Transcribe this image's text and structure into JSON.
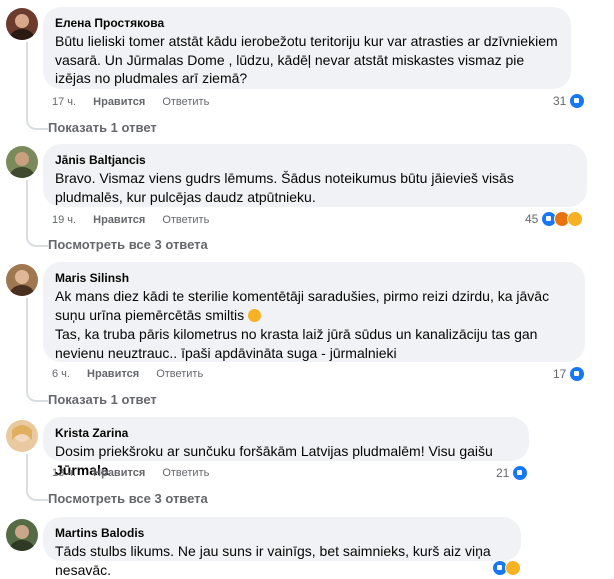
{
  "comments": [
    {
      "author": "Елена Простякова",
      "text": "Būtu lieliski tomer atstāt kādu ierobežotu teritoriju kur var atrasties ar dzīvniekiem vasarā. Un Jūrmalas Dome , lūdzu, kādēļ nevar atstāt miskastes vismaz pie izējas no pludmales arī ziemā?",
      "time": "17 ч.",
      "like_label": "Нравится",
      "reply_label": "Ответить",
      "reaction_count": "31",
      "replies_label": "Показать 1 ответ",
      "avatar_color": "#6b3b2e"
    },
    {
      "author": "Jānis Baltjancis",
      "text": "Bravo. Vismaz viens gudrs lēmums. Šādus noteikumus būtu jāievieš visās pludmalēs, kur pulcējas daudz atpūtnieku.",
      "time": "19 ч.",
      "like_label": "Нравится",
      "reply_label": "Ответить",
      "reaction_count": "45",
      "replies_label": "Посмотреть все 3 ответа",
      "avatar_color": "#7a8a5a"
    },
    {
      "author": "Maris Silinsh",
      "text_line1": "Ak mans diez kādi te sterilie komentētāji saradušies, pirmo reizi dzirdu, ka jāvāc suņu urīna piemērcētās smiltis",
      "text_line2": "Tas, ka truba pāris kilometrus no krasta laiž jūrā sūdus un kanalizāciju tas gan nevienu neuztrauc.. īpaši apdāvināta suga - jūrmalnieki",
      "time": "6 ч.",
      "like_label": "Нравится",
      "reply_label": "Ответить",
      "reaction_count": "17",
      "replies_label": "Показать 1 ответ",
      "avatar_color": "#a07850"
    },
    {
      "author": "Krista Zarina",
      "text": "Dosim priekšroku ar sunčuku foršākām Latvijas pludmalēm! Visu gaišu",
      "text_bold": "Jūrmala",
      "time": "13 ч.",
      "like_label": "Нравится",
      "reply_label": "Ответить",
      "reaction_count": "21",
      "replies_label": "Посмотреть все 3 ответа",
      "avatar_color": "#e8c9a0"
    },
    {
      "author": "Martins Balodis",
      "text": "Tāds stulbs likums. Ne jau suns ir vainīgs, bet saimnieks, kurš aiz viņa nesavāc.",
      "avatar_color": "#556b45"
    }
  ],
  "colors": {
    "bubble": "#f0f2f5",
    "meta": "#65676b",
    "like_blue": "#1877f2"
  }
}
